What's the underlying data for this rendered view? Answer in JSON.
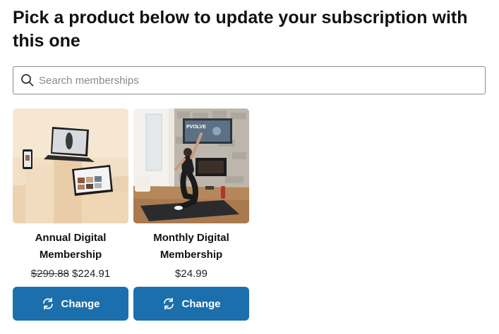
{
  "heading": "Pick a product below to update your subscription with this one",
  "search": {
    "placeholder": "Search memberships",
    "value": ""
  },
  "products": [
    {
      "name_line1": "Annual Digital",
      "name_line2": "Membership",
      "old_price": "$299.88",
      "price": "$224.91",
      "button_label": "Change",
      "image_icon": "devices-product-image"
    },
    {
      "name_line1": "Monthly Digital",
      "name_line2": "Membership",
      "price": "$24.99",
      "button_label": "Change",
      "image_icon": "workout-photo-image",
      "tv_brand": "PVOLVE"
    }
  ],
  "colors": {
    "button": "#1b6fad",
    "text": "#111111",
    "border": "#8c8c8c"
  }
}
